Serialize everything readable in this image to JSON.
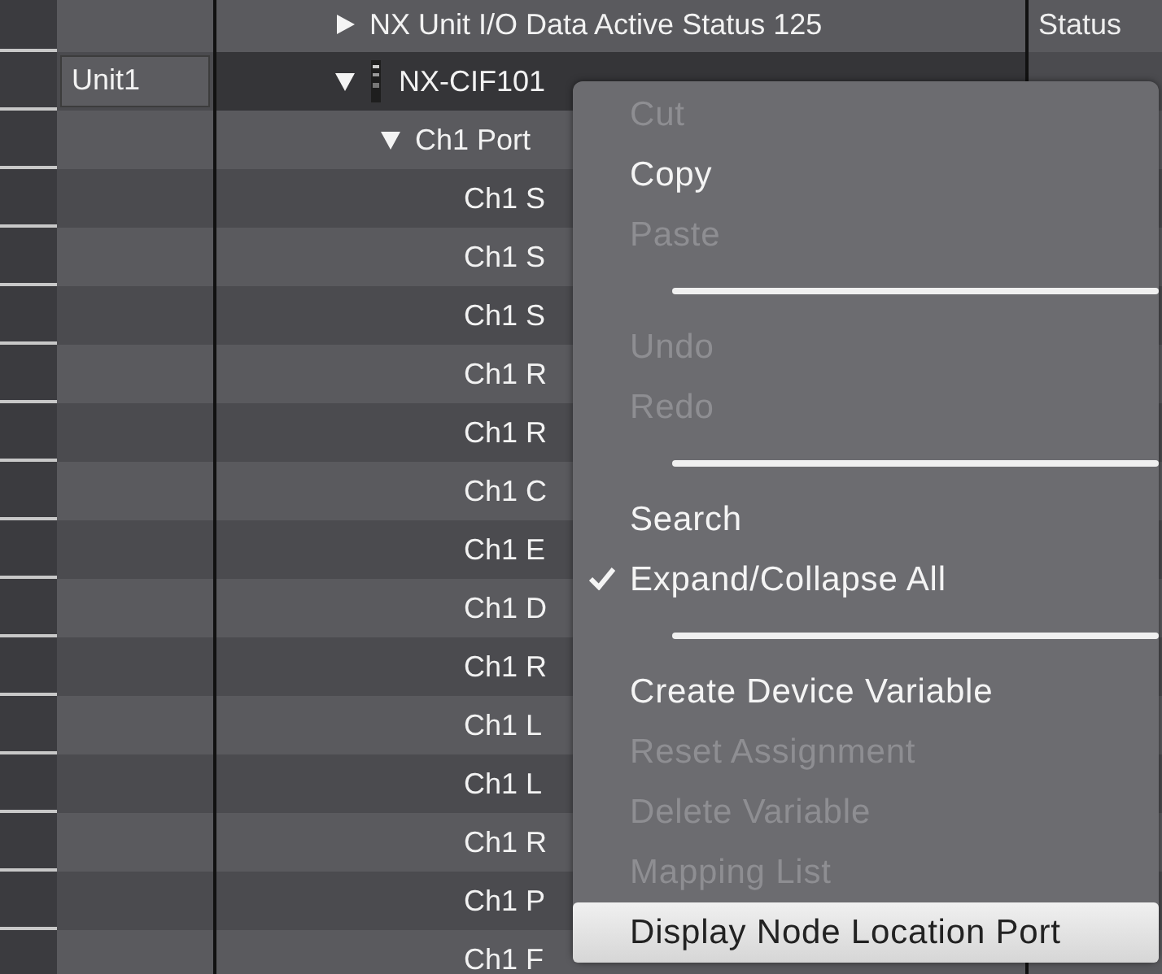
{
  "tree": [
    {
      "label": "NX Unit I/O Data Active Status 125",
      "expanded": false,
      "status": "Status"
    },
    {
      "label": "NX-CIF101",
      "unit": "Unit1",
      "expanded": true,
      "children": [
        {
          "label": "Ch1 Port",
          "expanded": true,
          "children": [
            {
              "label": "Ch1 S"
            },
            {
              "label": "Ch1 S"
            },
            {
              "label": "Ch1 S"
            },
            {
              "label": "Ch1 R"
            },
            {
              "label": "Ch1 R"
            },
            {
              "label": "Ch1 C"
            },
            {
              "label": "Ch1 E"
            },
            {
              "label": "Ch1 D"
            },
            {
              "label": "Ch1 R"
            },
            {
              "label": "Ch1 L"
            },
            {
              "label": "Ch1 L"
            },
            {
              "label": "Ch1 R"
            },
            {
              "label": "Ch1 P"
            },
            {
              "label": "Ch1 F"
            }
          ]
        }
      ]
    }
  ],
  "context_menu": [
    {
      "kind": "item",
      "label": "Cut",
      "disabled": true,
      "checked": false,
      "selected": false
    },
    {
      "kind": "item",
      "label": "Copy",
      "disabled": false,
      "checked": false,
      "selected": false
    },
    {
      "kind": "item",
      "label": "Paste",
      "disabled": true,
      "checked": false,
      "selected": false
    },
    {
      "kind": "separator"
    },
    {
      "kind": "item",
      "label": "Undo",
      "disabled": true,
      "checked": false,
      "selected": false
    },
    {
      "kind": "item",
      "label": "Redo",
      "disabled": true,
      "checked": false,
      "selected": false
    },
    {
      "kind": "separator"
    },
    {
      "kind": "item",
      "label": "Search",
      "disabled": false,
      "checked": false,
      "selected": false
    },
    {
      "kind": "item",
      "label": "Expand/Collapse All",
      "disabled": false,
      "checked": true,
      "selected": false
    },
    {
      "kind": "separator"
    },
    {
      "kind": "item",
      "label": "Create Device Variable",
      "disabled": false,
      "checked": false,
      "selected": false
    },
    {
      "kind": "item",
      "label": "Reset Assignment",
      "disabled": true,
      "checked": false,
      "selected": false
    },
    {
      "kind": "item",
      "label": "Delete Variable",
      "disabled": true,
      "checked": false,
      "selected": false
    },
    {
      "kind": "item",
      "label": "Mapping List",
      "disabled": true,
      "checked": false,
      "selected": false
    },
    {
      "kind": "item",
      "label": "Display Node Location Port",
      "disabled": false,
      "checked": false,
      "selected": true
    }
  ]
}
